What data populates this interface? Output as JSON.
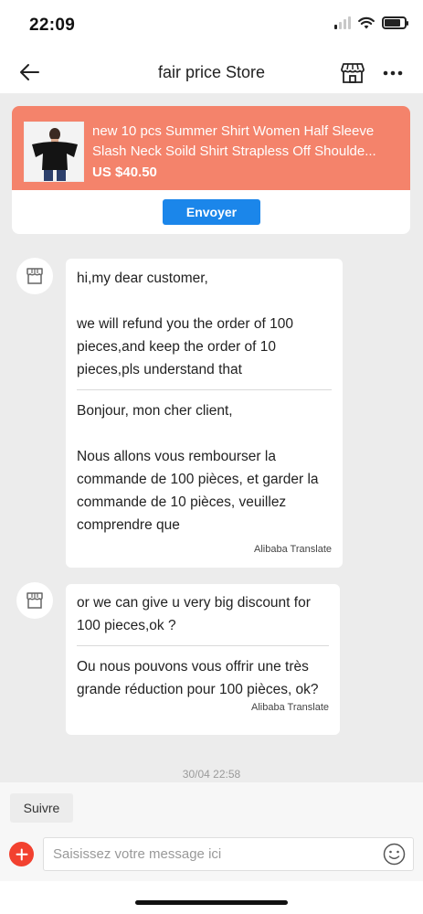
{
  "status_bar": {
    "time": "22:09",
    "signal_bars": 4,
    "signal_active": 1,
    "battery_level": 0.8,
    "icons": [
      "cellular-signal-icon",
      "wifi-icon",
      "battery-icon"
    ]
  },
  "header": {
    "title": "fair price Store",
    "back_icon": "back-arrow-icon",
    "store_icon": "storefront-icon",
    "more_icon": "more-dots-icon"
  },
  "product_card": {
    "title": "new 10 pcs Summer  Shirt Women Half Sleeve Slash Neck Soild Shirt Strapless Off Shoulde...",
    "price": "US $40.50",
    "send_label": "Envoyer",
    "thumbnail_icon": "product-thumbnail-image"
  },
  "messages": [
    {
      "sender": "store",
      "avatar_icon": "store-avatar-icon",
      "original": "hi,my dear customer,\n\nwe will refund you the order of 100 pieces,and keep the order of 10 pieces,pls understand that",
      "translated": "Bonjour, mon cher client,\n\nNous allons vous rembourser la commande de 100 pièces, et garder la commande de 10 pièces, veuillez comprendre que",
      "translate_tag": "Alibaba Translate"
    },
    {
      "sender": "store",
      "avatar_icon": "store-avatar-icon",
      "original": "or we can give u very big discount for 100 pieces,ok ?",
      "translated": "Ou nous pouvons vous offrir une très grande réduction pour 100 pièces, ok?",
      "translate_tag": "Alibaba Translate"
    }
  ],
  "timestamp": "30/04 22:58",
  "follow_label": "Suivre",
  "composer": {
    "placeholder": "Saisissez votre message ici",
    "plus_icon": "add-plus-icon",
    "emoji_icon": "emoji-smile-icon"
  },
  "colors": {
    "product_banner": "#f4836b",
    "send_button": "#1b86ea",
    "plus_button": "#f2412f",
    "chat_background": "#ececec"
  }
}
